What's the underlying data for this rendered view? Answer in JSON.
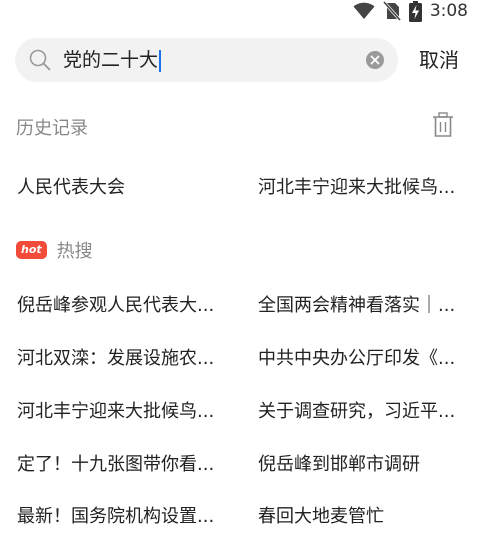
{
  "status": {
    "time": "3:08",
    "icons": [
      "wifi-icon",
      "no-sim-icon",
      "battery-charging-icon"
    ]
  },
  "search": {
    "query": "党的二十大",
    "cancel_label": "取消",
    "icons": [
      "search-icon",
      "clear-icon"
    ]
  },
  "history": {
    "title": "历史记录",
    "items": [
      "人民代表大会",
      "河北丰宁迎来大批候鸟..."
    ],
    "icon": "trash-icon"
  },
  "hot": {
    "badge": "hot",
    "title": "热搜",
    "items": [
      "倪岳峰参观人民代表大...",
      "全国两会精神看落实｜...",
      "河北双滦：发展设施农...",
      "中共中央办公厅印发《...",
      "河北丰宁迎来大批候鸟...",
      "关于调查研究，习近平...",
      "定了！十九张图带你看...",
      "倪岳峰到邯郸市调研",
      "最新！国务院机构设置...",
      "春回大地麦管忙"
    ]
  },
  "colors": {
    "accent_caret": "#1a73e8",
    "hot_badge": "#f24b3a",
    "muted_text": "#888888",
    "search_bg": "#f2f2f2"
  }
}
